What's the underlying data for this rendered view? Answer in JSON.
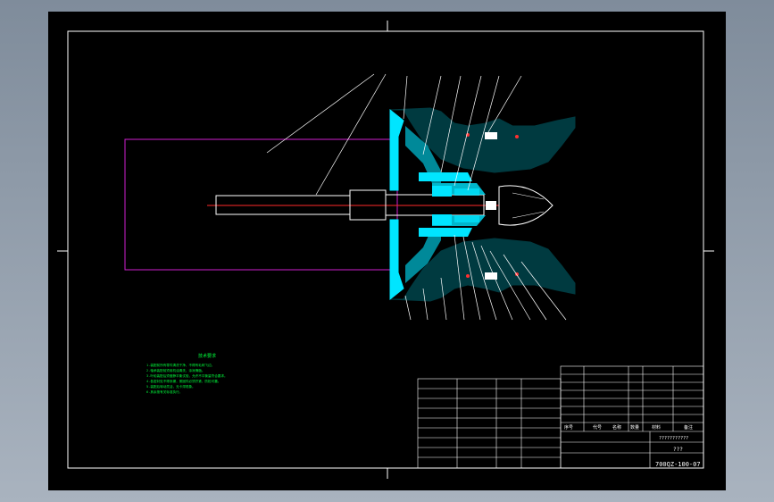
{
  "drawing": {
    "drawing_number": "700QZ-100-07",
    "title_name": "???",
    "title_placeholder": "???????????"
  },
  "title_block_headers": [
    "序号",
    "代号",
    "名称",
    "数量",
    "材料",
    "备注"
  ],
  "tech_requirements": {
    "heading": "技术要求",
    "lines": [
      "1.装配前所有零件清洗干净，不得有毛刺飞边。",
      "2.轴承装配前须用机油清洗，涂润滑脂。",
      "3.叶轮装配后须做静平衡试验，允许不平衡量符合要求。",
      "4.各密封处不得渗漏，紧固件必须拧紧，防松可靠。",
      "5.装配后转动灵活，无卡滞现象。",
      "6.其余按有关标准执行。"
    ]
  },
  "colors": {
    "background": "#000000",
    "frame": "#ffffff",
    "part": "#00e5ff",
    "centerline": "#ff2a2a",
    "envelope": "#d11fd1",
    "notes": "#00ff3c",
    "leader": "#ffffff"
  }
}
